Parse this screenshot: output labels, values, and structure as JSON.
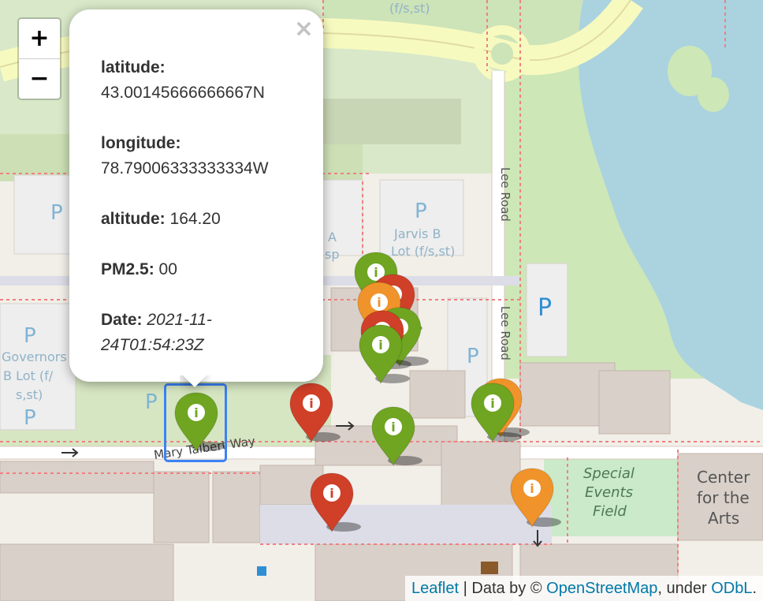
{
  "zoom": {
    "in_label": "+",
    "out_label": "−"
  },
  "popup": {
    "close_label": "×",
    "latitude_label": "latitude:",
    "latitude_value": "43.00145666666667N",
    "longitude_label": "longitude:",
    "longitude_value": "78.79006333333334W",
    "altitude_label": "altitude:",
    "altitude_value": "164.20",
    "pm_label": "PM2.5:",
    "pm_value": "00",
    "date_label": "Date:",
    "date_value": "2021-11-24T01:54:23Z"
  },
  "map_labels": {
    "lee_road_top": "Lee Road",
    "lee_road_bottom": "Lee Road",
    "mary_talbert_way": "Mary Talbert Way",
    "jarvis_lot_1": "Jarvis B",
    "jarvis_lot_2": "Lot (f/s,st)",
    "governors_lot_1": "Governors",
    "governors_lot_2": "B Lot (f/",
    "governors_lot_3": "s,st)",
    "special_events_1": "Special",
    "special_events_2": "Events",
    "special_events_3": "Field",
    "center_arts_1": "Center",
    "center_arts_2": "for the",
    "center_arts_3": "Arts",
    "top_lot": "(f/s,st)",
    "lot_a_1": "A",
    "lot_a_2": "sp",
    "parking_symbol": "P",
    "marker_glyph": "i"
  },
  "marker_colors": {
    "green": "#6fa521",
    "red": "#d03f28",
    "orange": "#f0932a"
  },
  "attribution": {
    "leaflet": "Leaflet",
    "sep": " | Data by © ",
    "osm": "OpenStreetMap",
    "under": ", under ",
    "odbl": "ODbL",
    "end": "."
  }
}
